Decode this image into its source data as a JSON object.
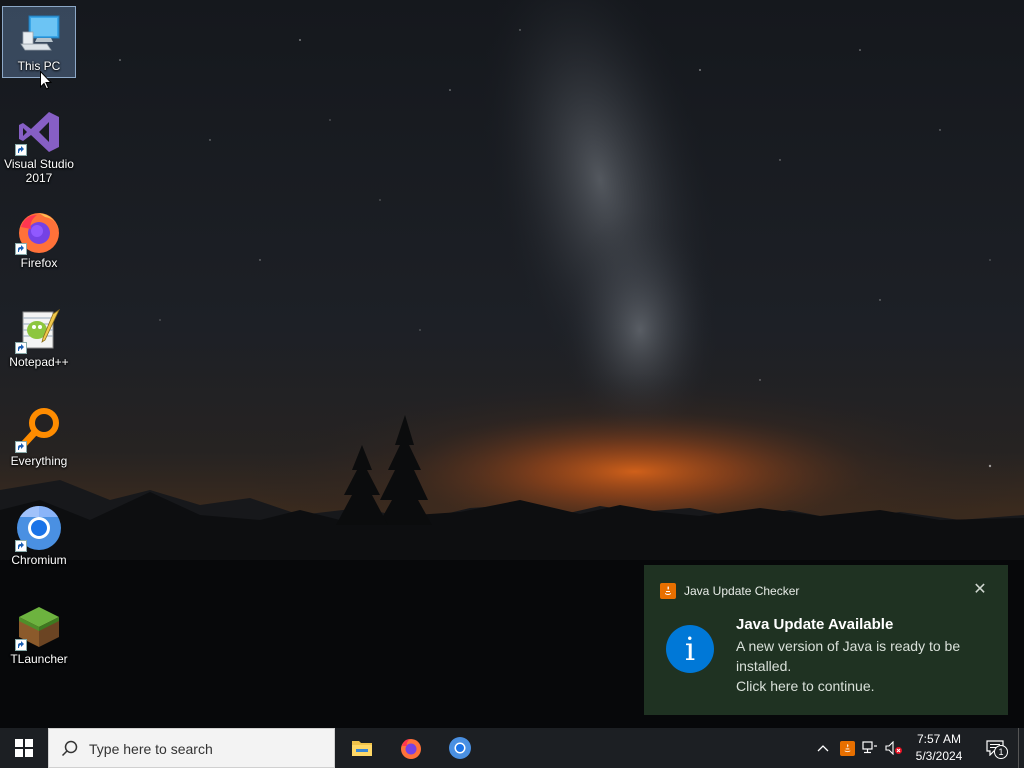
{
  "desktop": {
    "icons": [
      {
        "label": "This PC",
        "icon": "computer-icon"
      },
      {
        "label": "Visual Studio 2017",
        "icon": "visual-studio-icon"
      },
      {
        "label": "Firefox",
        "icon": "firefox-icon"
      },
      {
        "label": "Notepad++",
        "icon": "notepad-plus-plus-icon"
      },
      {
        "label": "Everything",
        "icon": "everything-search-icon"
      },
      {
        "label": "Chromium",
        "icon": "chromium-icon"
      },
      {
        "label": "TLauncher",
        "icon": "tlauncher-icon"
      }
    ]
  },
  "toast": {
    "app_name": "Java Update Checker",
    "title": "Java Update Available",
    "body": "A new version of Java is ready to be installed.",
    "action": "Click here to continue.",
    "accent": "#0078d7"
  },
  "taskbar": {
    "search_placeholder": "Type here to search",
    "pinned": [
      "file-explorer-icon",
      "firefox-icon",
      "chromium-icon"
    ],
    "clock_time": "7:57 AM",
    "clock_date": "5/3/2024",
    "notification_count": "1",
    "background": "#1c1f23"
  }
}
